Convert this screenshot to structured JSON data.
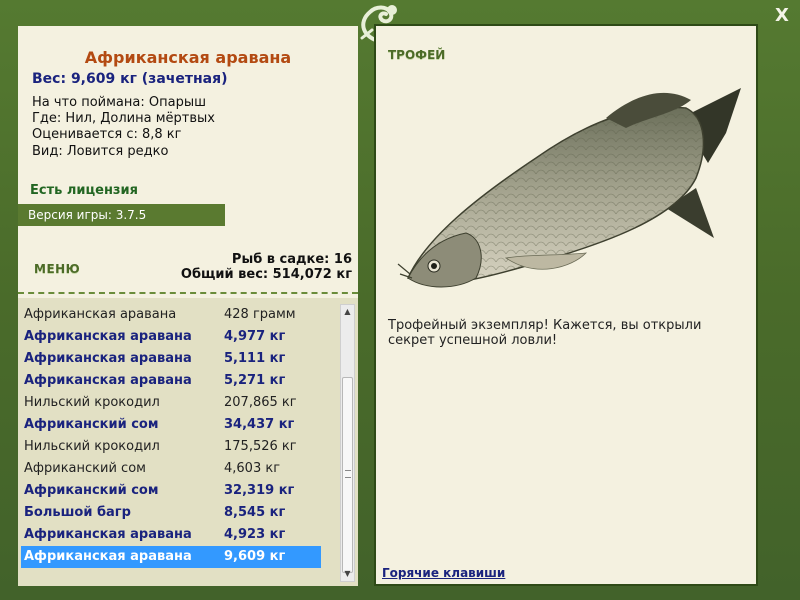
{
  "window": {
    "close_label": "X"
  },
  "fish": {
    "title": "Африканская аравана",
    "weight": "Вес: 9,609 кг (зачетная)",
    "caught_with": "На что поймана: Опарыш",
    "location": "Где: Нил, Долина мёртвых",
    "value": "Оценивается с: 8,8 кг",
    "rarity": "Вид: Ловится редко"
  },
  "license": "Есть лицензия",
  "version": "Версия игры: 3.7.5",
  "menu_label": "МЕНЮ",
  "stats": {
    "fish_count": "Рыб в садке: 16",
    "total_weight": "Общий вес: 514,072 кг"
  },
  "catch_list": [
    {
      "name": "Африканская аравана",
      "weight": "428 грамм",
      "style": "plain"
    },
    {
      "name": "Африканская аравана",
      "weight": "4,977 кг",
      "style": "bold"
    },
    {
      "name": "Африканская аравана",
      "weight": "5,111 кг",
      "style": "bold"
    },
    {
      "name": "Африканская аравана",
      "weight": "5,271 кг",
      "style": "bold"
    },
    {
      "name": "Нильский крокодил",
      "weight": "207,865 кг",
      "style": "plain"
    },
    {
      "name": "Африканский сом",
      "weight": "34,437 кг",
      "style": "bold"
    },
    {
      "name": "Нильский крокодил",
      "weight": "175,526 кг",
      "style": "plain"
    },
    {
      "name": "Африканский сом",
      "weight": "4,603 кг",
      "style": "plain"
    },
    {
      "name": "Африканский сом",
      "weight": "32,319 кг",
      "style": "bold"
    },
    {
      "name": "Большой багр",
      "weight": "8,545 кг",
      "style": "bold"
    },
    {
      "name": "Африканская аравана",
      "weight": "4,923 кг",
      "style": "bold"
    },
    {
      "name": "Африканская аравана",
      "weight": "9,609 кг",
      "style": "selected"
    }
  ],
  "scrollbar": {
    "up_icon": "▲",
    "down_icon": "▼"
  },
  "trophy": {
    "label": "ТРОФЕЙ",
    "text": "Трофейный экземпляр! Кажется, вы открыли секрет успешной ловли!"
  },
  "hotkeys_label": "Горячие клавиши",
  "colors": {
    "frame_green": "#4a6b2a",
    "panel_bg": "#f4f1e0",
    "title_orange": "#b34a12",
    "navy": "#1a237e",
    "selection_blue": "#3399ff"
  }
}
